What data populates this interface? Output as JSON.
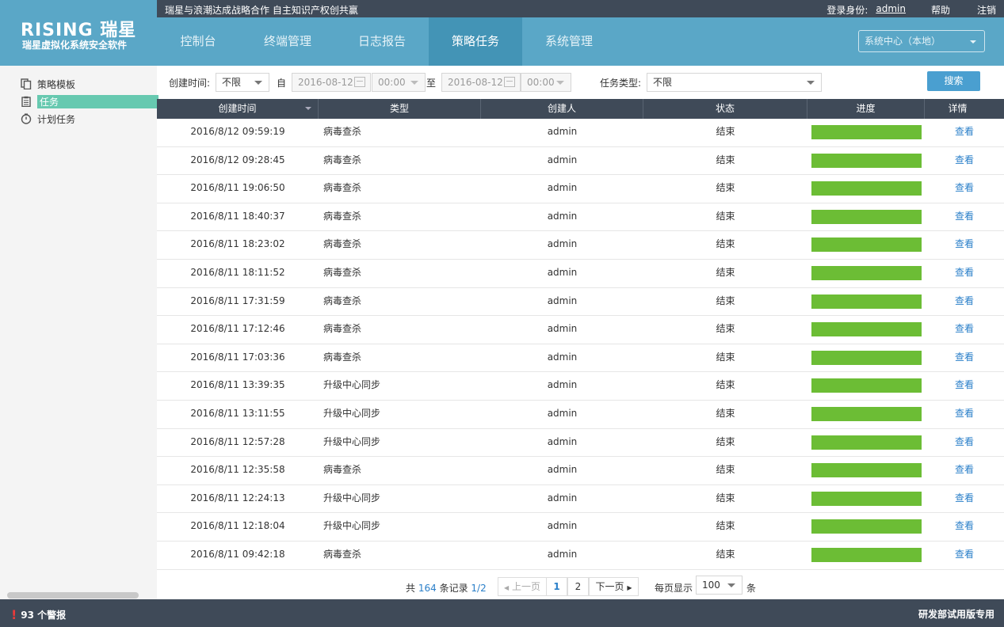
{
  "topbar": {
    "slogan": "瑞星与浪潮达成战略合作 自主知识产权创共赢",
    "login_label": "登录身份:",
    "user": "admin",
    "help": "帮助",
    "logout": "注销"
  },
  "logo": {
    "brand": "RISING 瑞星",
    "subtitle": "瑞星虚拟化系统安全软件"
  },
  "nav": {
    "tabs": [
      "控制台",
      "终端管理",
      "日志报告",
      "策略任务",
      "系统管理"
    ],
    "active": "策略任务",
    "center_select": "系统中心（本地）"
  },
  "sidebar": {
    "items": [
      {
        "label": "策略模板",
        "icon": "copy-icon"
      },
      {
        "label": "任务",
        "icon": "clipboard-icon",
        "active": true
      },
      {
        "label": "计划任务",
        "icon": "clock-icon"
      }
    ]
  },
  "filter": {
    "created_label": "创建时间:",
    "range_select": "不限",
    "from_label": "自",
    "from_date": "2016-08-12",
    "from_time": "00:00",
    "to_label": "至",
    "to_date": "2016-08-12",
    "to_time": "00:00",
    "type_label": "任务类型:",
    "type_select": "不限",
    "search_button": "搜索"
  },
  "table": {
    "headers": [
      "创建时间",
      "类型",
      "创建人",
      "状态",
      "进度",
      "详情"
    ],
    "rows": [
      {
        "time": "2016/8/12 09:59:19",
        "type": "病毒查杀",
        "user": "admin",
        "status": "结束",
        "progress": 1.0,
        "link": "查看"
      },
      {
        "time": "2016/8/12 09:28:45",
        "type": "病毒查杀",
        "user": "admin",
        "status": "结束",
        "progress": 1.0,
        "link": "查看"
      },
      {
        "time": "2016/8/11 19:06:50",
        "type": "病毒查杀",
        "user": "admin",
        "status": "结束",
        "progress": 1.0,
        "link": "查看"
      },
      {
        "time": "2016/8/11 18:40:37",
        "type": "病毒查杀",
        "user": "admin",
        "status": "结束",
        "progress": 1.0,
        "link": "查看"
      },
      {
        "time": "2016/8/11 18:23:02",
        "type": "病毒查杀",
        "user": "admin",
        "status": "结束",
        "progress": 1.0,
        "link": "查看"
      },
      {
        "time": "2016/8/11 18:11:52",
        "type": "病毒查杀",
        "user": "admin",
        "status": "结束",
        "progress": 1.0,
        "link": "查看"
      },
      {
        "time": "2016/8/11 17:31:59",
        "type": "病毒查杀",
        "user": "admin",
        "status": "结束",
        "progress": 1.0,
        "link": "查看"
      },
      {
        "time": "2016/8/11 17:12:46",
        "type": "病毒查杀",
        "user": "admin",
        "status": "结束",
        "progress": 1.0,
        "link": "查看"
      },
      {
        "time": "2016/8/11 17:03:36",
        "type": "病毒查杀",
        "user": "admin",
        "status": "结束",
        "progress": 1.0,
        "link": "查看"
      },
      {
        "time": "2016/8/11 13:39:35",
        "type": "升级中心同步",
        "user": "admin",
        "status": "结束",
        "progress": 1.0,
        "link": "查看"
      },
      {
        "time": "2016/8/11 13:11:55",
        "type": "升级中心同步",
        "user": "admin",
        "status": "结束",
        "progress": 1.0,
        "link": "查看"
      },
      {
        "time": "2016/8/11 12:57:28",
        "type": "升级中心同步",
        "user": "admin",
        "status": "结束",
        "progress": 1.0,
        "link": "查看"
      },
      {
        "time": "2016/8/11 12:35:58",
        "type": "病毒查杀",
        "user": "admin",
        "status": "结束",
        "progress": 1.0,
        "link": "查看"
      },
      {
        "time": "2016/8/11 12:24:13",
        "type": "升级中心同步",
        "user": "admin",
        "status": "结束",
        "progress": 1.0,
        "link": "查看"
      },
      {
        "time": "2016/8/11 12:18:04",
        "type": "升级中心同步",
        "user": "admin",
        "status": "结束",
        "progress": 1.0,
        "link": "查看"
      },
      {
        "time": "2016/8/11 09:42:18",
        "type": "病毒查杀",
        "user": "admin",
        "status": "结束",
        "progress": 1.0,
        "link": "查看"
      }
    ]
  },
  "pager": {
    "total_prefix": "共",
    "total_count": "164",
    "total_suffix": "条记录",
    "page_status": "1/2",
    "prev": "上一页",
    "pages": [
      "1",
      "2"
    ],
    "next": "下一页",
    "per_page_label": "每页显示",
    "per_page_value": "100",
    "per_page_unit": "条"
  },
  "footer": {
    "alarm_icon": "!",
    "alarms": "93 个警报",
    "edition": "研发部试用版专用"
  },
  "colors": {
    "nav_bg": "#5aa7c7",
    "nav_active": "#4394b6",
    "dark_bar": "#3f4a58",
    "progress": "#6cbd35",
    "link": "#2a7fc9",
    "sidebar_active": "#67c9b0",
    "alarm": "#e83a3a"
  }
}
